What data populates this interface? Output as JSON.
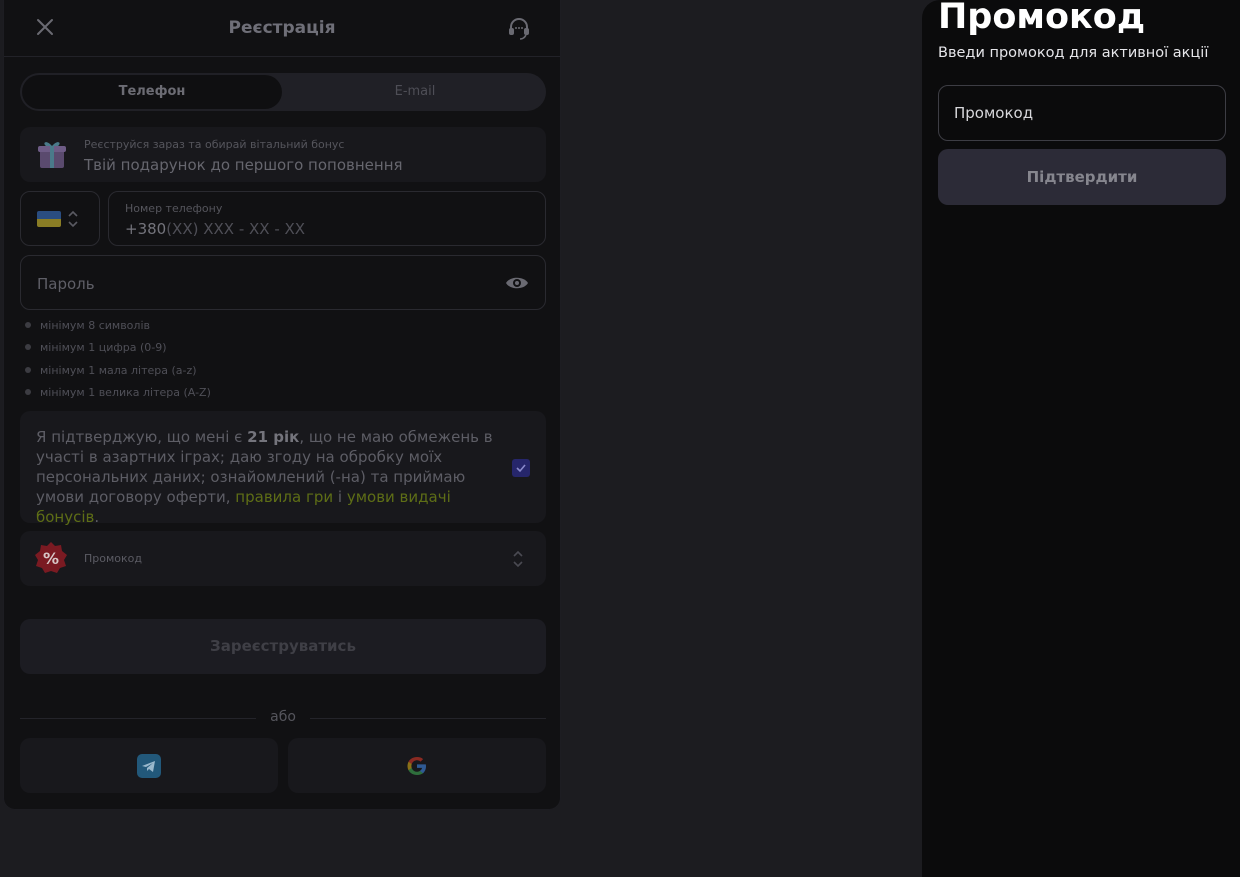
{
  "registration": {
    "title": "Реєстрація",
    "tabs": [
      {
        "label": "Телефон",
        "active": true
      },
      {
        "label": "E-mail",
        "active": false
      }
    ],
    "bonus": {
      "caption": "Реєструйся зараз та обирай вітальний бонус",
      "text": "Твій подарунок до першого поповнення",
      "icon": "gift-icon"
    },
    "country": {
      "flag": "ukraine-flag-icon"
    },
    "phone": {
      "label": "Номер телефону",
      "prefix": "+380",
      "mask": "(XX) XXX - XX - XX"
    },
    "password": {
      "placeholder": "Пароль"
    },
    "rules": [
      "мінімум 8 символів",
      "мінімум 1 цифра (0-9)",
      "мінімум 1 мала літера (a-z)",
      "мінімум 1 велика літера (A-Z)"
    ],
    "consent": {
      "part1": "Я підтверджую, що мені є ",
      "age": "21 рік",
      "part2": ", що не маю обмежень в участі в азартних іграх; даю згоду на обробку моїх персональних даних; ознайомлений (-на) та приймаю умови договору оферти, ",
      "link_rules": "правила гри",
      "and": " і ",
      "link_bonus": "умови видачі бонусів",
      "end": ".",
      "checked": true
    },
    "promo_row": {
      "label": "Промокод",
      "icon": "percent-badge-icon"
    },
    "register_label": "Зареєструватись",
    "or_label": "або",
    "social": [
      "telegram-icon",
      "google-icon"
    ]
  },
  "promo_panel": {
    "title": "Промокод",
    "subtitle": "Введи промокод для активної акції",
    "input_placeholder": "Промокод",
    "input_value": "",
    "confirm_label": "Підтвердити"
  },
  "colors": {
    "page_bg": "#1c1c20",
    "panel_bg": "#0b0b0c",
    "confirm_bg": "#2c2b37",
    "link": "#5e6e16",
    "checkbox": "#26266b"
  }
}
